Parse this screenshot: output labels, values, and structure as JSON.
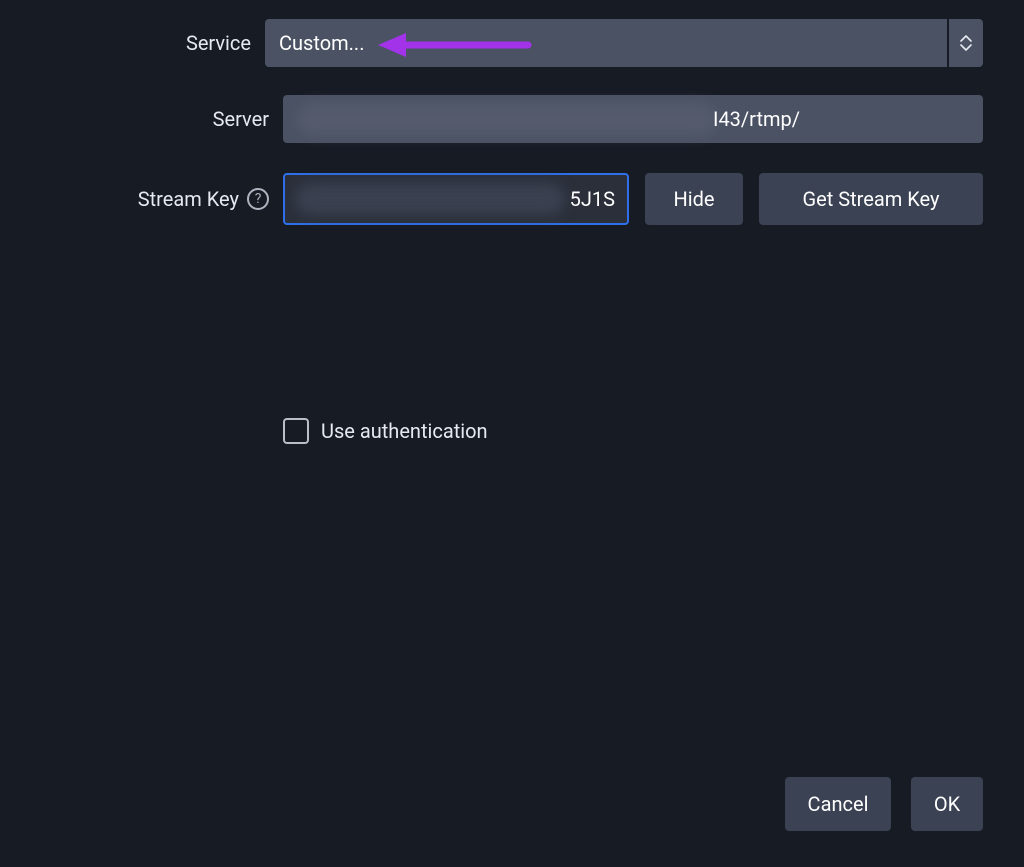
{
  "labels": {
    "service": "Service",
    "server": "Server",
    "stream_key": "Stream Key",
    "use_auth": "Use authentication"
  },
  "service": {
    "selected": "Custom..."
  },
  "server": {
    "visible_fragment": "I43/rtmp/"
  },
  "stream_key": {
    "visible_fragment": "5J1S"
  },
  "buttons": {
    "hide": "Hide",
    "get_stream_key": "Get Stream Key",
    "cancel": "Cancel",
    "ok": "OK"
  },
  "help_icon_glyph": "?",
  "auth_checked": false
}
